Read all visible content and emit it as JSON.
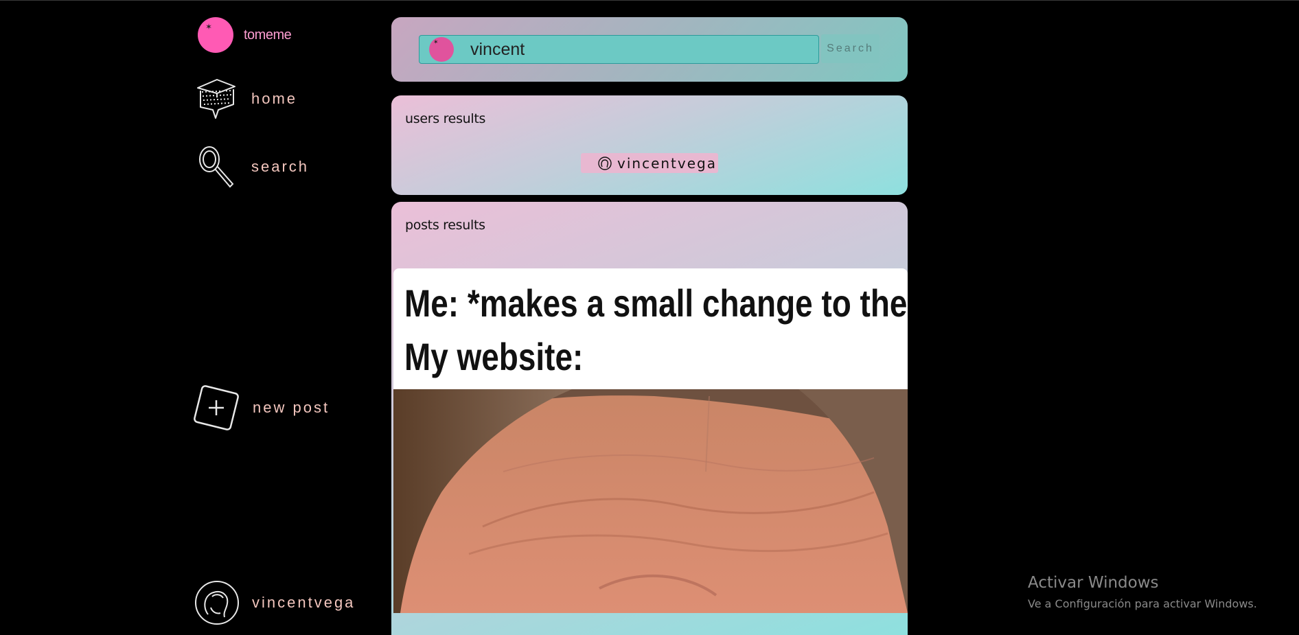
{
  "brand": {
    "name": "tomeme",
    "logo_icon": "pink-ball-logo-icon"
  },
  "sidebar": {
    "items": [
      {
        "label": "home",
        "icon": "house-icon"
      },
      {
        "label": "search",
        "icon": "magnifier-icon"
      },
      {
        "label": "new post",
        "icon": "plus-square-icon"
      },
      {
        "label": "vincentvega",
        "icon": "profile-avatar-icon"
      }
    ]
  },
  "search": {
    "value": "vincent",
    "button_label": "Search"
  },
  "users_results": {
    "title": "users results",
    "users": [
      {
        "username": "vincentvega",
        "icon": "user-avatar-icon"
      }
    ]
  },
  "posts_results": {
    "title": "posts results",
    "posts": [
      {
        "meme_text": [
          "Me: *makes a small change to the CSS*",
          "My website:"
        ],
        "image": "close-up-face-photo"
      }
    ]
  },
  "os_watermark": {
    "line1": "Activar Windows",
    "line2": "Ve a Configuración para activar Windows."
  },
  "colors": {
    "background": "#000000",
    "accent_pink": "#ff5ab4",
    "nav_text": "#f4c7bf",
    "teal": "#7ec7c1"
  }
}
